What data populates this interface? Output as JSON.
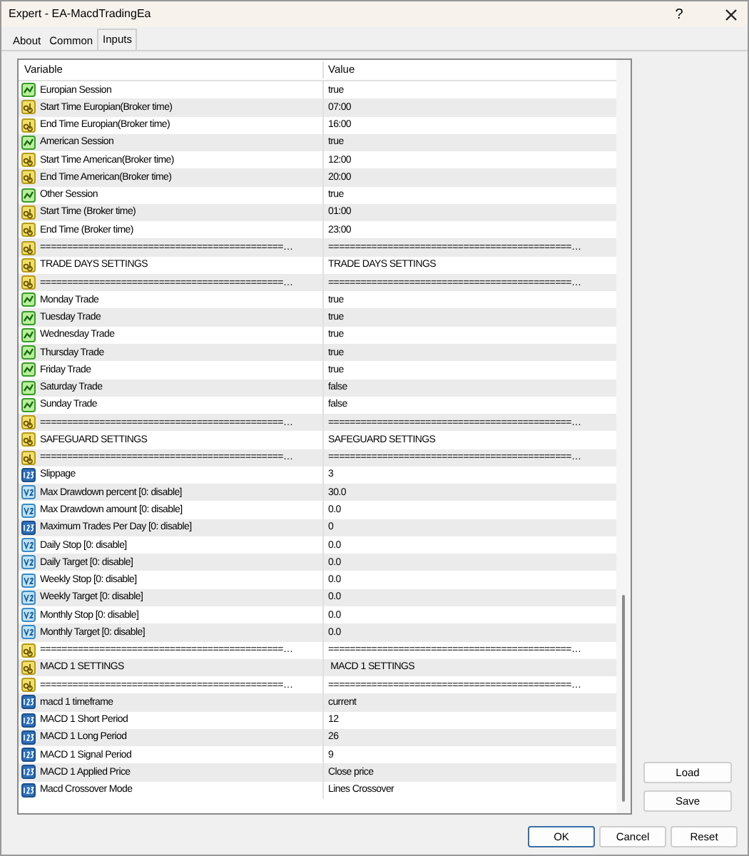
{
  "window": {
    "title": "Expert - EA-MacdTradingEa",
    "help_button": "?"
  },
  "tabs": [
    {
      "label": "About",
      "selected": false
    },
    {
      "label": "Common",
      "selected": false
    },
    {
      "label": "Inputs",
      "selected": true
    }
  ],
  "table": {
    "columns": [
      "Variable",
      "Value"
    ],
    "rows": [
      {
        "kind": "bool",
        "variable": "Europian Session",
        "value": "true"
      },
      {
        "kind": "string",
        "variable": "Start Time Europian(Broker time)",
        "value": "07:00"
      },
      {
        "kind": "string",
        "variable": "End Time Europian(Broker time)",
        "value": "16:00"
      },
      {
        "kind": "bool",
        "variable": "American Session",
        "value": "true"
      },
      {
        "kind": "string",
        "variable": "Start Time American(Broker time)",
        "value": "12:00"
      },
      {
        "kind": "string",
        "variable": "End Time American(Broker time)",
        "value": "20:00"
      },
      {
        "kind": "bool",
        "variable": "Other Session",
        "value": "true"
      },
      {
        "kind": "string",
        "variable": "Start Time (Broker time)",
        "value": "01:00"
      },
      {
        "kind": "string",
        "variable": "End Time (Broker time)",
        "value": "23:00"
      },
      {
        "kind": "string",
        "variable": "=============================================…",
        "value": "=============================================…"
      },
      {
        "kind": "string",
        "variable": "TRADE DAYS SETTINGS",
        "value": "TRADE DAYS SETTINGS"
      },
      {
        "kind": "string",
        "variable": "=============================================…",
        "value": "=============================================…"
      },
      {
        "kind": "bool",
        "variable": "Monday Trade",
        "value": "true"
      },
      {
        "kind": "bool",
        "variable": "Tuesday Trade",
        "value": "true"
      },
      {
        "kind": "bool",
        "variable": "Wednesday Trade",
        "value": "true"
      },
      {
        "kind": "bool",
        "variable": "Thursday Trade",
        "value": "true"
      },
      {
        "kind": "bool",
        "variable": "Friday Trade",
        "value": "true"
      },
      {
        "kind": "bool",
        "variable": "Saturday Trade",
        "value": "false"
      },
      {
        "kind": "bool",
        "variable": "Sunday Trade",
        "value": "false"
      },
      {
        "kind": "string",
        "variable": "=============================================…",
        "value": "=============================================…"
      },
      {
        "kind": "string",
        "variable": "SAFEGUARD SETTINGS",
        "value": "SAFEGUARD SETTINGS"
      },
      {
        "kind": "string",
        "variable": "=============================================…",
        "value": "=============================================…"
      },
      {
        "kind": "int",
        "variable": "Slippage",
        "value": "3"
      },
      {
        "kind": "double",
        "variable": "Max Drawdown percent [0: disable]",
        "value": "30.0"
      },
      {
        "kind": "double",
        "variable": "Max Drawdown amount [0: disable]",
        "value": "0.0"
      },
      {
        "kind": "int",
        "variable": "Maximum Trades Per Day [0: disable]",
        "value": "0"
      },
      {
        "kind": "double",
        "variable": "Daily Stop [0: disable]",
        "value": "0.0"
      },
      {
        "kind": "double",
        "variable": "Daily Target [0: disable]",
        "value": "0.0"
      },
      {
        "kind": "double",
        "variable": "Weekly Stop [0: disable]",
        "value": "0.0"
      },
      {
        "kind": "double",
        "variable": "Weekly Target [0: disable]",
        "value": "0.0"
      },
      {
        "kind": "double",
        "variable": "Monthly Stop [0: disable]",
        "value": "0.0"
      },
      {
        "kind": "double",
        "variable": "Monthly Target [0: disable]",
        "value": "0.0"
      },
      {
        "kind": "string",
        "variable": "=============================================…",
        "value": "=============================================…"
      },
      {
        "kind": "string",
        "variable": "MACD 1 SETTINGS",
        "value": " MACD 1 SETTINGS"
      },
      {
        "kind": "string",
        "variable": "=============================================…",
        "value": "=============================================…"
      },
      {
        "kind": "int",
        "variable": "macd 1 timeframe",
        "value": "current"
      },
      {
        "kind": "int",
        "variable": "MACD 1 Short Period",
        "value": "12"
      },
      {
        "kind": "int",
        "variable": "MACD 1 Long Period",
        "value": "26"
      },
      {
        "kind": "int",
        "variable": "MACD 1 Signal Period",
        "value": "9"
      },
      {
        "kind": "int",
        "variable": "MACD 1 Applied Price",
        "value": "Close price"
      },
      {
        "kind": "int",
        "variable": "Macd Crossover Mode",
        "value": "Lines Crossover"
      }
    ]
  },
  "side_buttons": [
    "Load",
    "Save"
  ],
  "buttons": [
    "OK",
    "Cancel",
    "Reset"
  ]
}
